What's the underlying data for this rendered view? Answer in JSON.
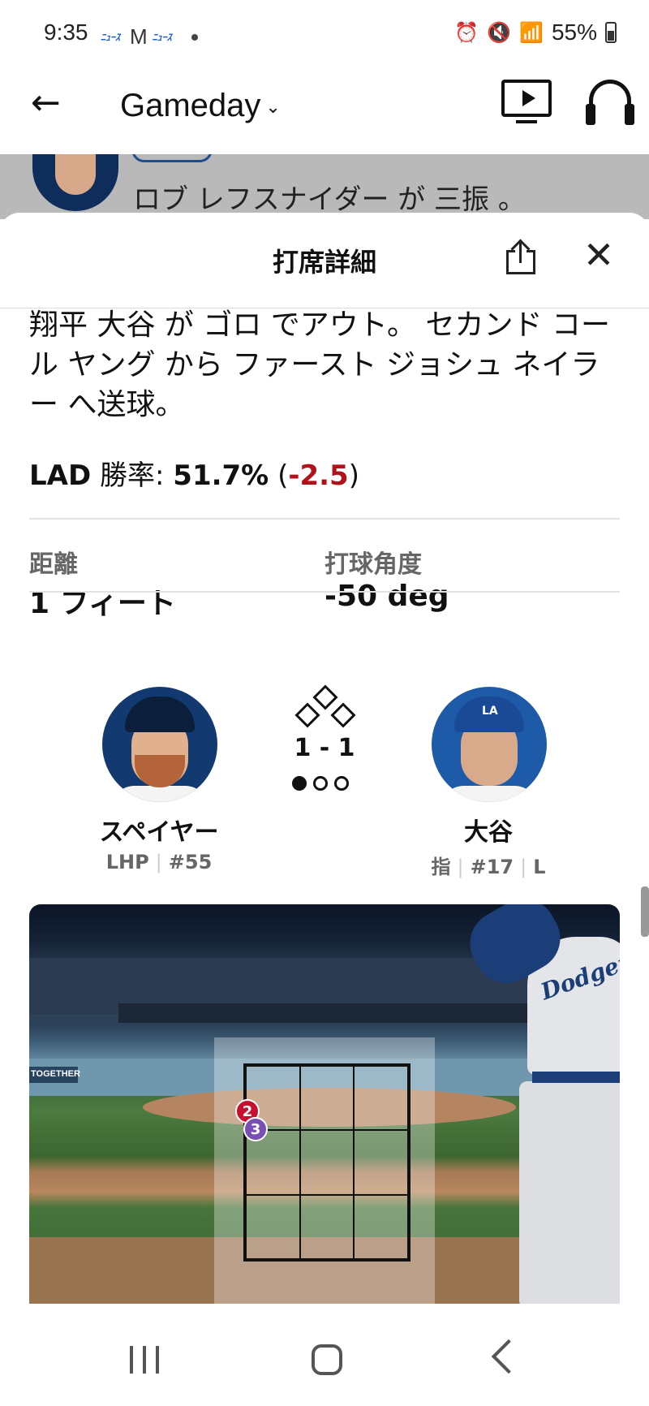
{
  "status_bar": {
    "time": "9:35",
    "battery": "55%",
    "icons": [
      "news-icon",
      "gmail-icon",
      "news-icon",
      "notification-dot-icon",
      "alarm-icon",
      "mute-icon",
      "wifi-icon",
      "signal-icon",
      "battery-icon"
    ]
  },
  "app_bar": {
    "title": "Gameday",
    "dropdown_glyph": "⌄"
  },
  "background_play": {
    "text": "ロブ レフスナイダー が 三振 。"
  },
  "sheet": {
    "title": "打席詳細",
    "close_glyph": "✕",
    "description": "翔平 大谷 が ゴロ でアウト。 セカンド コール ヤング から ファースト ジョシュ ネイラー へ送球。",
    "win_prob": {
      "team": "LAD",
      "label": "勝率:",
      "pct": "51.7%",
      "delta": "-2.5"
    },
    "stats": {
      "distance_label": "距離",
      "distance_value": "1 フィート",
      "launch_angle_label": "打球角度",
      "launch_angle_value": "-50 deg"
    },
    "matchup": {
      "pitcher": {
        "name": "スペイヤー",
        "hand": "LHP",
        "number": "#55"
      },
      "batter": {
        "name": "大谷",
        "position": "指",
        "number": "#17",
        "bats": "L"
      },
      "count": "1 - 1",
      "outs": 1,
      "outs_max": 3
    },
    "pitch_viz": {
      "banner_text": "TOGETHER",
      "jersey_script": "Dodgers",
      "pitches": [
        {
          "number": "2",
          "color": "#c8102e"
        },
        {
          "number": "3",
          "color": "#7a4fb3"
        }
      ]
    }
  },
  "colors": {
    "accent_red": "#b0121b",
    "pitch_red": "#c8102e",
    "pitch_purple": "#7a4fb3"
  }
}
